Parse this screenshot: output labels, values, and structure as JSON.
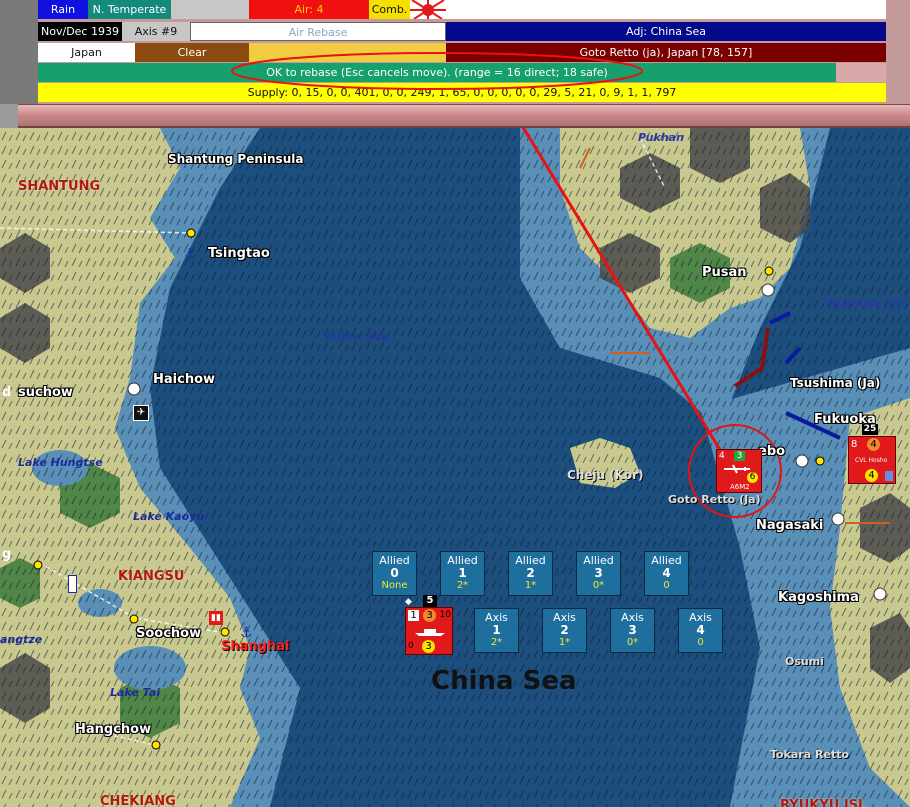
{
  "top_bar": {
    "weather": "Rain",
    "zone": "N. Temperate",
    "air": "Air: 4",
    "combat": "Comb.",
    "date": "Nov/Dec 1939",
    "axis_impulse": "Axis #9",
    "action": "Air Rebase",
    "adjacent": "Adj: China Sea",
    "major_power": "Japan",
    "weather_state": "Clear",
    "location": "Goto Retto (ja), Japan [78, 157]",
    "status_message": "OK to rebase (Esc cancels move). (range = 16 direct; 18 safe)",
    "supply": "Supply: 0, 15, 0, 0, 401, 0, 0, 249, 1, 65, 0, 0, 0, 0, 0, 29, 5, 21, 0, 9, 1, 1, 797"
  },
  "colors": {
    "rain_bg": "#1010e0",
    "zone_bg": "#138a7c",
    "air_bg": "#f01010",
    "combat_bg": "#f6e000",
    "adj_bg": "#000a8a",
    "location_bg": "#7a0000",
    "clear_bg": "#8a4a10",
    "status_bg": "#16a06e",
    "supply_bg": "#ffff00",
    "japan_red": "#e01a1a",
    "sea": "#1c4e7e",
    "land": "#c9c98f",
    "annotation_red": "#e81212"
  },
  "map": {
    "labels": {
      "shantung_peninsula": "Shantung Peninsula",
      "shantung": "SHANTUNG",
      "tsingtao": "Tsingtao",
      "yellow_sea": "Yellow Sea",
      "haichow": "Haichow",
      "suchow": "suchow",
      "lake_hungtse": "Lake Hungtse",
      "lake_kaoyu": "Lake Kaoyu",
      "kiangsu": "KIANGSU",
      "soochow": "Soochow",
      "shanghai": "Shanghai",
      "lake_tai": "Lake Tai",
      "hangchow": "Hangchow",
      "chekiang": "CHEKIANG",
      "yangtze": "angtze",
      "pukhan": "Pukhan",
      "pusan": "Pusan",
      "tsushima_strait": "Tsushima Str",
      "tsushima": "Tsushima (Ja)",
      "fukuoka": "Fukuoka",
      "sasebo": "ebo",
      "cheju": "Cheju (Kor)",
      "goto_retto": "Goto Retto (Ja)",
      "nagasaki": "Nagasaki",
      "kagoshima": "Kagoshima",
      "osumi": "Osumi",
      "tokara_retto": "Tokara Retto",
      "china_sea": "China Sea",
      "ryukyu": "RYUKYU ISL",
      "left_edge": "d",
      "left_edge2": "g"
    },
    "combat_boxes": {
      "allied": [
        {
          "label": "Allied",
          "num": "0",
          "val": "None"
        },
        {
          "label": "Allied",
          "num": "1",
          "val": "2*"
        },
        {
          "label": "Allied",
          "num": "2",
          "val": "1*"
        },
        {
          "label": "Allied",
          "num": "3",
          "val": "0*"
        },
        {
          "label": "Allied",
          "num": "4",
          "val": "0"
        }
      ],
      "axis": [
        {
          "label": "Axis",
          "num": "1",
          "val": "2*"
        },
        {
          "label": "Axis",
          "num": "2",
          "val": "1*"
        },
        {
          "label": "Axis",
          "num": "3",
          "val": "0*"
        },
        {
          "label": "Axis",
          "num": "4",
          "val": "0"
        }
      ]
    },
    "units": {
      "goto_unit": {
        "top_left": "4",
        "top_right": "3",
        "bottom_right": "6",
        "name": "A6M2"
      },
      "fukuoka_unit": {
        "stack": "25",
        "tl": "8",
        "tr": "4",
        "br": "4",
        "name": "CVL Hosho"
      },
      "sea_stack": {
        "count": "5",
        "tl": "1",
        "tr": "3",
        "br": "10",
        "bl": "0",
        "bottom": "3"
      }
    }
  }
}
